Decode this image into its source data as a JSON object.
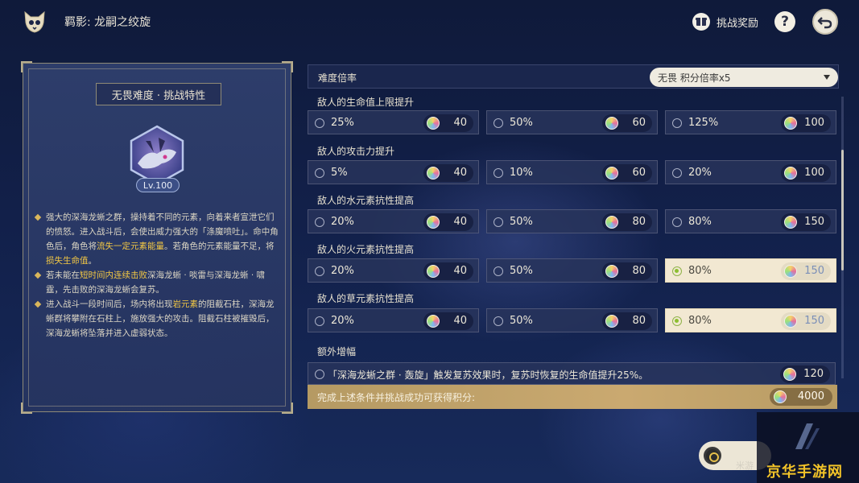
{
  "header": {
    "title": "羁影: 龙嗣之绞旋",
    "reward_label": "挑战奖励",
    "help_label": "?"
  },
  "left_panel": {
    "title": "无畏难度 · 挑战特性",
    "boss_level": "Lv.100",
    "description": [
      {
        "segments": [
          {
            "text": "强大的深海龙蜥之群，操持着不同的元素，向着来者宣泄它们的愤怒。进入战斗后，会使出威力强大的「涤魔喷吐」。命中角色后，角色将",
            "hl": false
          },
          {
            "text": "流失一定元素能量",
            "hl": true
          },
          {
            "text": "。若角色的元素能量不足，将",
            "hl": false
          },
          {
            "text": "损失生命值",
            "hl": true
          },
          {
            "text": "。",
            "hl": false
          }
        ]
      },
      {
        "segments": [
          {
            "text": "若未能在",
            "hl": false
          },
          {
            "text": "短时间内连续击败",
            "hl": true
          },
          {
            "text": "深海龙蜥 · 啖雷与深海龙蜥 · 啸霆，先击败的深海龙蜥会复苏。",
            "hl": false
          }
        ]
      },
      {
        "segments": [
          {
            "text": "进入战斗一段时间后，场内将出现",
            "hl": false
          },
          {
            "text": "岩元素",
            "hl": true
          },
          {
            "text": "的阻截石柱，深海龙蜥群将攀附在石柱上，施放强大的攻击。阻截石柱被摧毁后，深海龙蜥将坠落并进入虚弱状态。",
            "hl": false
          }
        ]
      }
    ]
  },
  "difficulty": {
    "label": "难度倍率",
    "selected": "无畏  积分倍率x5"
  },
  "sections": [
    {
      "title": "敌人的生命值上限提升",
      "options": [
        {
          "label": "25%",
          "points": "40",
          "selected": false
        },
        {
          "label": "50%",
          "points": "60",
          "selected": false
        },
        {
          "label": "125%",
          "points": "100",
          "selected": false
        }
      ]
    },
    {
      "title": "敌人的攻击力提升",
      "options": [
        {
          "label": "5%",
          "points": "40",
          "selected": false
        },
        {
          "label": "10%",
          "points": "60",
          "selected": false
        },
        {
          "label": "20%",
          "points": "100",
          "selected": false
        }
      ]
    },
    {
      "title": "敌人的水元素抗性提高",
      "options": [
        {
          "label": "20%",
          "points": "40",
          "selected": false
        },
        {
          "label": "50%",
          "points": "80",
          "selected": false
        },
        {
          "label": "80%",
          "points": "150",
          "selected": false
        }
      ]
    },
    {
      "title": "敌人的火元素抗性提高",
      "options": [
        {
          "label": "20%",
          "points": "40",
          "selected": false
        },
        {
          "label": "50%",
          "points": "80",
          "selected": false
        },
        {
          "label": "80%",
          "points": "150",
          "selected": true
        }
      ]
    },
    {
      "title": "敌人的草元素抗性提高",
      "options": [
        {
          "label": "20%",
          "points": "40",
          "selected": false
        },
        {
          "label": "50%",
          "points": "80",
          "selected": false
        },
        {
          "label": "80%",
          "points": "150",
          "selected": true
        }
      ]
    }
  ],
  "extra": {
    "title": "额外增幅",
    "option": {
      "label": "「深海龙蜥之群 · 轰旋」触发复苏效果时，复苏时恢复的生命值提升25%。",
      "points": "120",
      "selected": false
    }
  },
  "footer": {
    "text": "完成上述条件并挑战成功可获得积分:",
    "points": "4000"
  },
  "watermark": {
    "sub": "米游",
    "logo": "京华手游网"
  },
  "colors": {
    "highlight": "#f3c844",
    "selected_bg": "#f2e8d2",
    "footer_gold": "#caa970"
  }
}
